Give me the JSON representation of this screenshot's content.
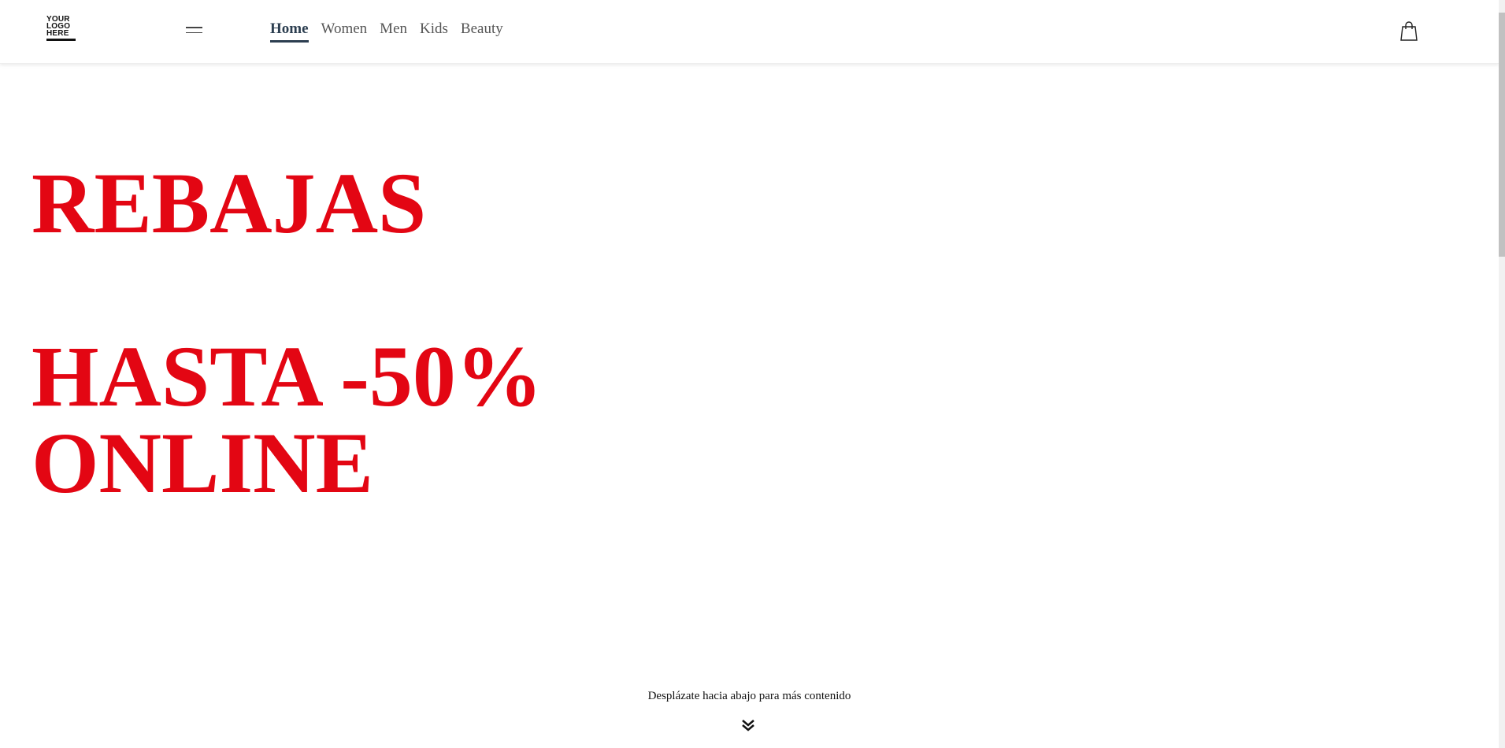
{
  "header": {
    "logo_text": "YOUR LOGO HERE",
    "nav": [
      {
        "label": "Home",
        "active": true
      },
      {
        "label": "Women",
        "active": false
      },
      {
        "label": "Men",
        "active": false
      },
      {
        "label": "Kids",
        "active": false
      },
      {
        "label": "Beauty",
        "active": false
      }
    ],
    "icons": {
      "menu": "hamburger-icon",
      "cart": "shopping-bag-icon"
    }
  },
  "hero": {
    "lines": [
      "REBAJAS",
      "",
      "HASTA -50%",
      "ONLINE"
    ],
    "color": "#e30613"
  },
  "scroll_hint": {
    "text": "Desplázate hacia abajo para más contenido",
    "icon": "double-chevron-down-icon"
  }
}
